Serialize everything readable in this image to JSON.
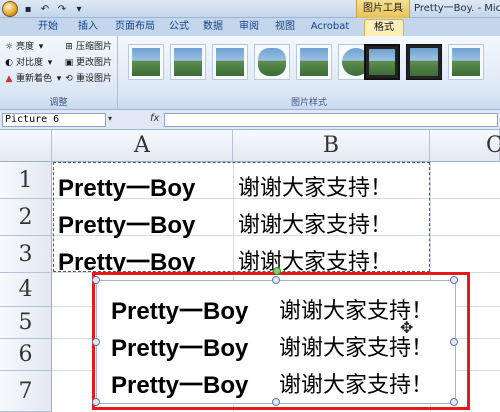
{
  "titlebar": {
    "picture_tools_label": "图片工具",
    "window_title": "Pretty一Boy.  -  Micro"
  },
  "tabs": [
    "开始",
    "插入",
    "页面布局",
    "公式",
    "数据",
    "审阅",
    "视图",
    "Acrobat",
    "格式"
  ],
  "adjust_group": {
    "label": "调整",
    "brightness": "亮度",
    "contrast": "对比度",
    "recolor": "重新着色",
    "compress": "压缩图片",
    "change": "更改图片",
    "reset": "重设图片"
  },
  "styles_group": {
    "label": "图片样式"
  },
  "formula_bar": {
    "name_box": "Picture 6",
    "fx": "fx",
    "formula": ""
  },
  "columns": [
    "A",
    "B",
    "C"
  ],
  "rows": [
    "1",
    "2",
    "3",
    "4",
    "5",
    "6",
    "7"
  ],
  "cells": [
    {
      "a": "Pretty一Boy",
      "b": "谢谢大家支持！"
    },
    {
      "a": "Pretty一Boy",
      "b": "谢谢大家支持！"
    },
    {
      "a": "Pretty一Boy",
      "b": "谢谢大家支持！"
    }
  ],
  "picture_rows": [
    {
      "a": "Pretty一Boy",
      "b": "谢谢大家支持！"
    },
    {
      "a": "Pretty一Boy",
      "b": "谢谢大家支持！"
    },
    {
      "a": "Pretty一Boy",
      "b": "谢谢大家支持！"
    }
  ],
  "colors": {
    "callout": "#e31b1b",
    "ribbon": "#dbe6f4",
    "context_tab": "#fbeeb8"
  }
}
